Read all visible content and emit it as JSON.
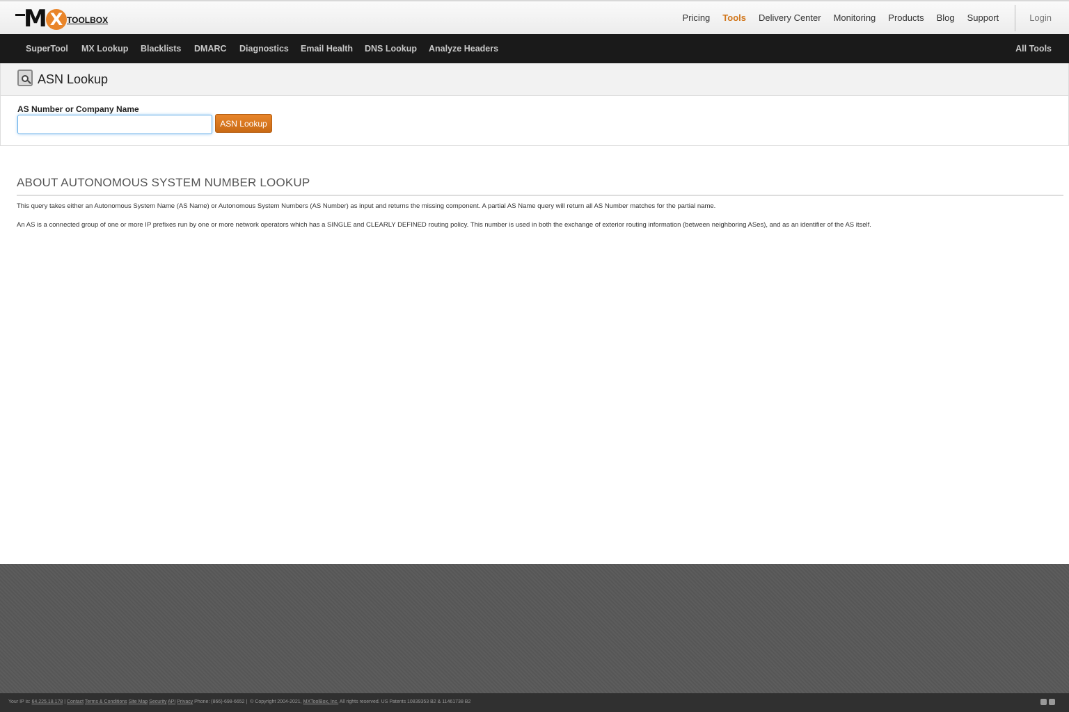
{
  "logo": {
    "mark": "M",
    "x_letter": "X",
    "wordmark": "TOOLBOX"
  },
  "top_nav": {
    "items": [
      "Pricing",
      "Tools",
      "Delivery Center",
      "Monitoring",
      "Products",
      "Blog",
      "Support"
    ],
    "active": "Tools",
    "login": "Login",
    "accent_color": "#d1761b"
  },
  "tools_bar": {
    "items": [
      "SuperTool",
      "MX Lookup",
      "Blacklists",
      "DMARC",
      "Diagnostics",
      "Email Health",
      "DNS Lookup",
      "Analyze Headers"
    ],
    "all_tools": "All Tools"
  },
  "tool": {
    "title": "ASN Lookup",
    "field_label": "AS Number or Company Name",
    "input_value": "",
    "button_label": "ASN Lookup",
    "icon": "search-document-icon"
  },
  "about": {
    "title": "ABOUT AUTONOMOUS SYSTEM NUMBER LOOKUP",
    "p1": "This query takes either an Autonomous System Name (AS Name) or Autonomous System Numbers (AS Number) as input and returns the missing component. A partial AS Name query will return all AS Number matches for the partial name.",
    "p2": "An AS is a connected group of one or more IP prefixes run by one or more network operators which has a SINGLE and CLEARLY DEFINED routing policy. This number is used in both the exchange of exterior routing information (between neighboring ASes), and as an identifier of the AS itself."
  },
  "footer": {
    "ip_label": "Your IP is:",
    "ip": "64.225.18.178",
    "links": [
      "Contact",
      "Terms & Conditions",
      "Site Map",
      "Security",
      "API",
      "Privacy"
    ],
    "phone": "Phone: (866)-698-6652 |",
    "copyright": "© Copyright 2004-2021,",
    "company": "MXToolBox, Inc.",
    "rights": "All rights reserved. US Patents 10839353 B2 & 11461738 B2",
    "social_icons": [
      "twitter-icon",
      "youtube-icon"
    ]
  }
}
